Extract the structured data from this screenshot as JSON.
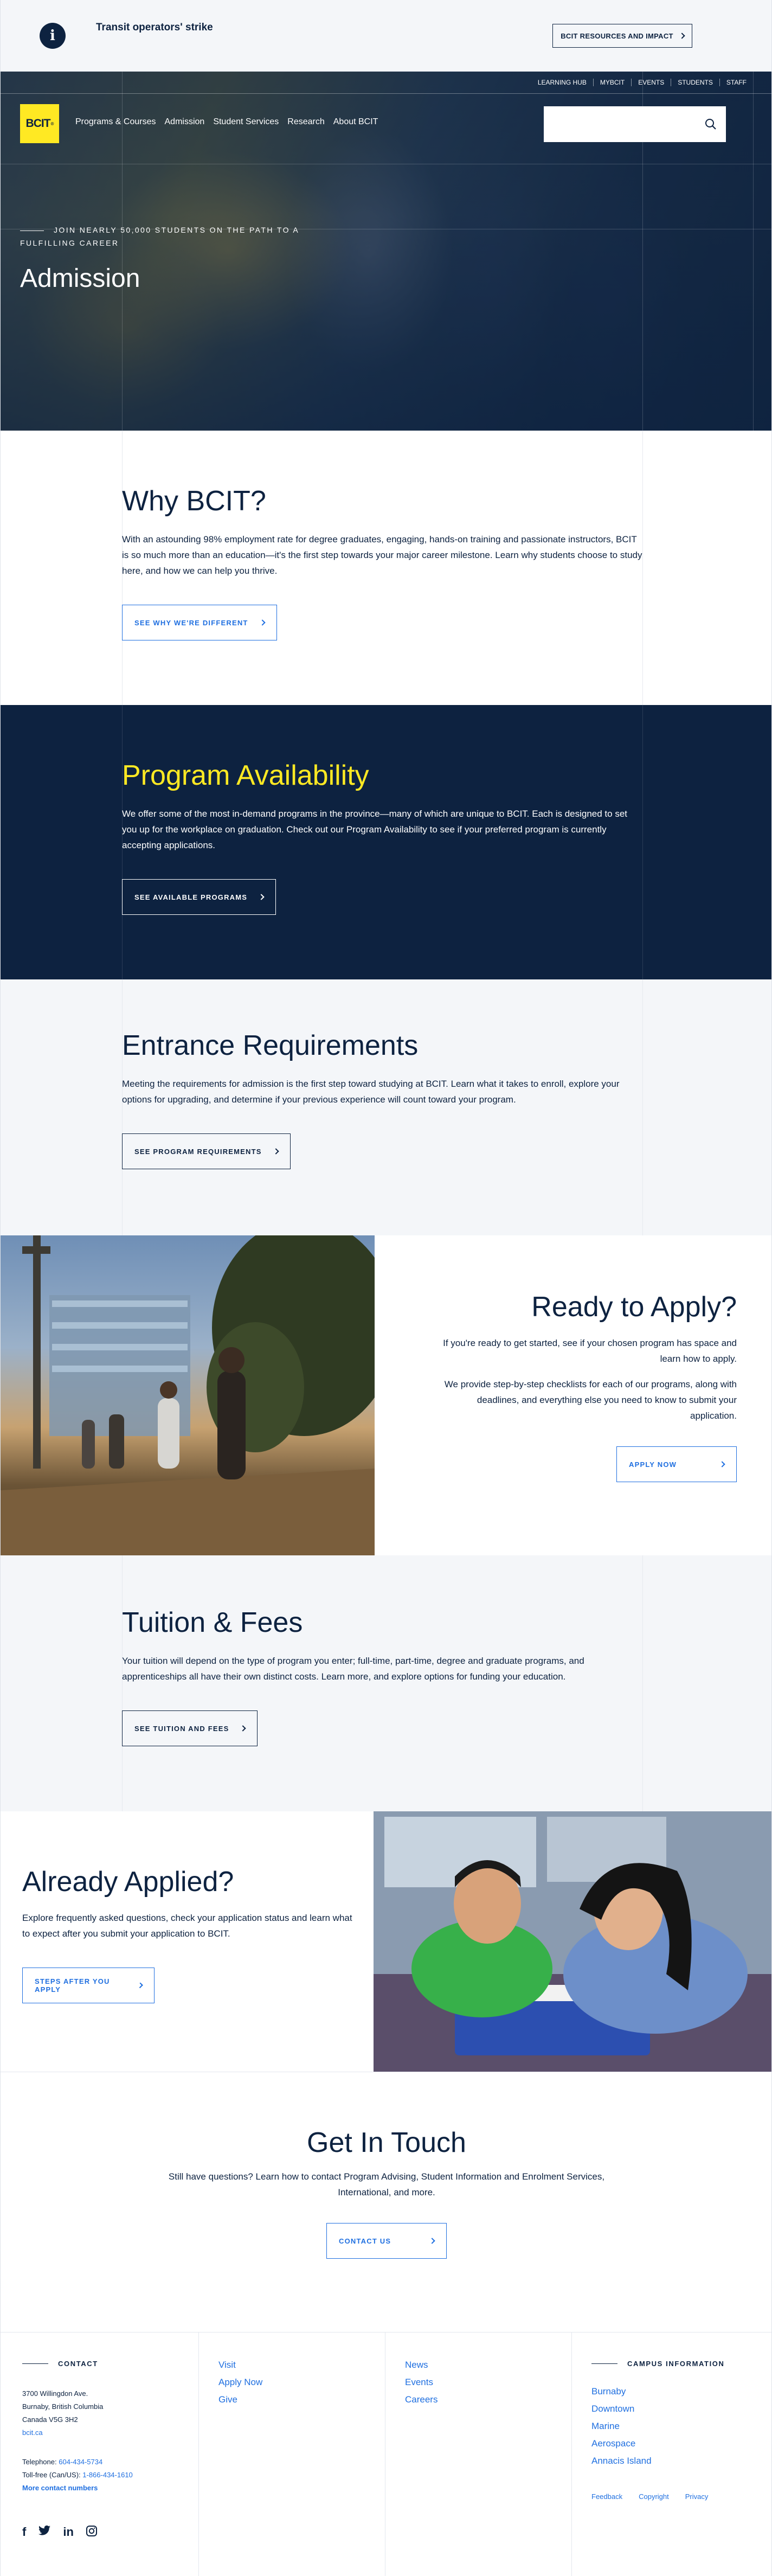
{
  "alert": {
    "icon": "info-icon",
    "icon_glyph": "i",
    "text": "Transit operators' strike",
    "button_label": "BCIT RESOURCES AND IMPACT"
  },
  "utility_nav": [
    "LEARNING HUB",
    "MYBCIT",
    "EVENTS",
    "STUDENTS",
    "STAFF"
  ],
  "logo": {
    "text": "BCIT",
    "mark": "®"
  },
  "main_nav": [
    "Programs & Courses",
    "Admission",
    "Student Services",
    "Research",
    "About BCIT"
  ],
  "search": {
    "placeholder": "",
    "icon": "search-icon"
  },
  "hero": {
    "kicker": "JOIN NEARLY 50,000 STUDENTS ON THE PATH TO A FULFILLING CAREER",
    "title": "Admission"
  },
  "why": {
    "title": "Why BCIT?",
    "body": "With an astounding 98% employment rate for degree graduates, engaging, hands-on training and passionate instructors, BCIT is so much more than an education—it's the first step towards your major career milestone. Learn why students choose to study here, and how we can help you thrive.",
    "button": "SEE WHY WE'RE DIFFERENT"
  },
  "availability": {
    "title": "Program Availability",
    "body": "We offer some of the most in-demand programs in the province—many of which are unique to BCIT. Each is designed to set you up for the workplace on graduation. Check out our Program Availability to see if your preferred program is currently accepting applications.",
    "button": "SEE AVAILABLE PROGRAMS"
  },
  "entrance": {
    "title": "Entrance Requirements",
    "body": "Meeting the requirements for admission is the first step toward studying at BCIT. Learn what it takes to enroll, explore your options for upgrading, and determine if your previous experience will count toward your program.",
    "button": "SEE PROGRAM REQUIREMENTS"
  },
  "apply": {
    "title": "Ready to Apply?",
    "body1": "If you're ready to get started, see if your chosen program has space and learn how to apply.",
    "body2": "We provide step-by-step checklists for each of our programs, along with deadlines, and everything else you need to know to submit your application.",
    "button": "APPLY NOW"
  },
  "tuition": {
    "title": "Tuition & Fees",
    "body": "Your tuition will depend on the type of program you enter; full-time, part-time, degree and graduate programs, and apprenticeships all have their own distinct costs. Learn more, and explore options for funding your education.",
    "button": "SEE TUITION AND FEES"
  },
  "applied": {
    "title": "Already Applied?",
    "body": "Explore frequently asked questions, check your application status and learn what to expect after you submit your application to BCIT.",
    "button": "STEPS AFTER YOU APPLY"
  },
  "touch": {
    "title": "Get In Touch",
    "body": "Still have questions? Learn how to contact Program Advising, Student Information and Enrolment Services, International, and more.",
    "button": "CONTACT US"
  },
  "footer": {
    "contact_heading": "CONTACT",
    "address": [
      "3700 Willingdon Ave.",
      "Burnaby, British Columbia",
      "Canada V5G 3H2"
    ],
    "site": "bcit.ca",
    "telephone_label": "Telephone:",
    "telephone": "604-434-5734",
    "tollfree_label": "Toll-free (Can/US):",
    "tollfree": "1-866-434-1610",
    "more_contacts": "More contact numbers",
    "col2": [
      "Visit",
      "Apply Now",
      "Give"
    ],
    "col3": [
      "News",
      "Events",
      "Careers"
    ],
    "campus_heading": "CAMPUS INFORMATION",
    "campuses": [
      "Burnaby",
      "Downtown",
      "Marine",
      "Aerospace",
      "Annacis Island"
    ],
    "legal": [
      "Feedback",
      "Copyright",
      "Privacy"
    ],
    "social": [
      "facebook-icon",
      "twitter-icon",
      "linkedin-icon",
      "instagram-icon"
    ]
  },
  "colors": {
    "navy": "#0d2240",
    "yellow": "#ffe923",
    "blue": "#1f6fe0",
    "light_bg": "#f4f6f9"
  }
}
